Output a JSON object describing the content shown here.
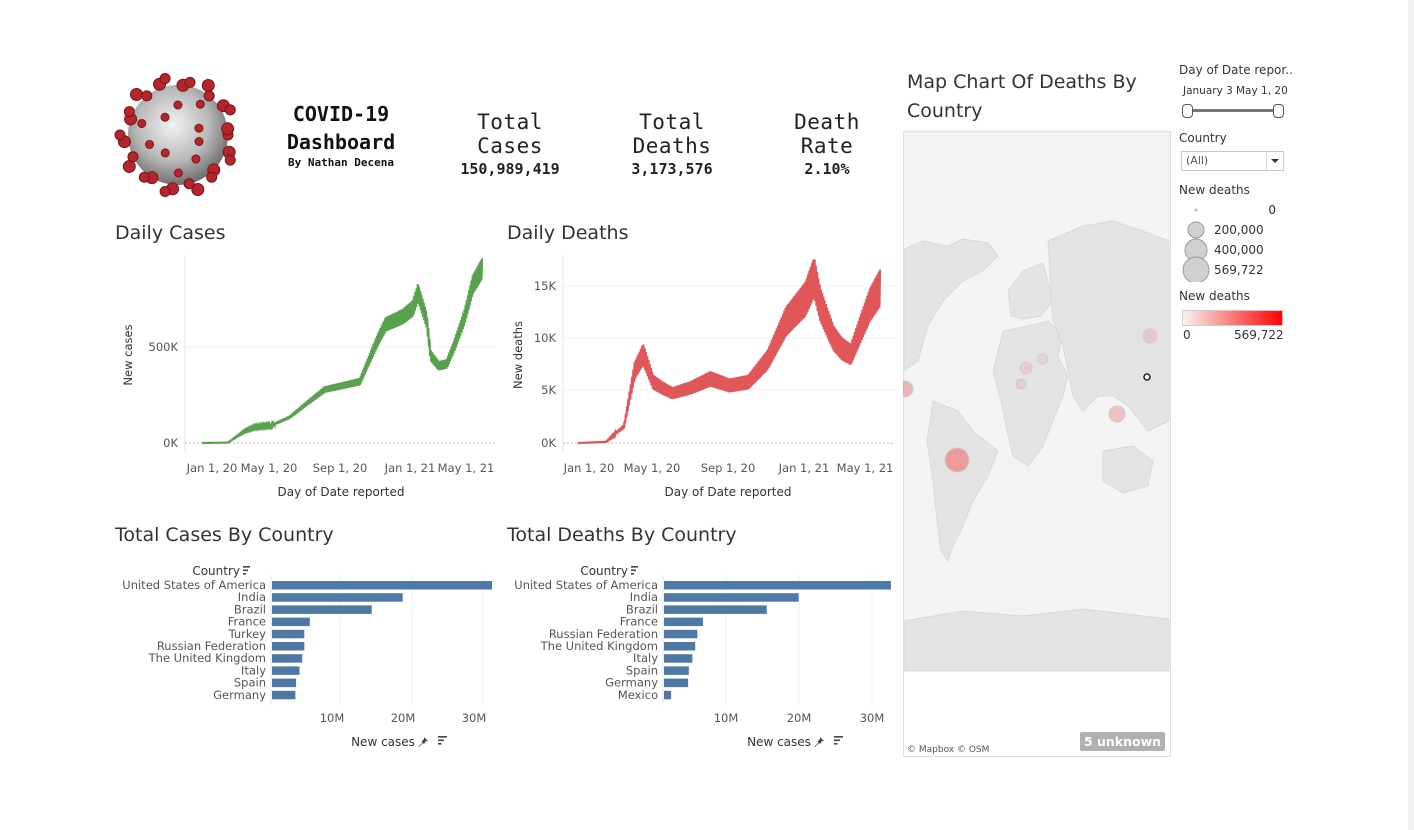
{
  "header": {
    "title": "COVID-19 Dashboard",
    "title_line1": "COVID-19",
    "title_line2": "Dashboard",
    "subtitle": "By Nathan Decena",
    "kpis": [
      {
        "label": "Total Cases",
        "value": "150,989,419"
      },
      {
        "label": "Total Deaths",
        "value": "3,173,576"
      },
      {
        "label": "Death Rate",
        "value": "2.10%"
      }
    ]
  },
  "colors": {
    "cases_line": "#59a14f",
    "deaths_line": "#e15759",
    "bar": "#4e79a7",
    "map_land": "#e6e6e6",
    "map_water": "#ffffff"
  },
  "daily_cases": {
    "title": "Daily Cases",
    "xlabel": "Day of Date reported",
    "ylabel": "New cases",
    "ticks_x": [
      "Jan 1, 20",
      "May 1, 20",
      "Sep 1, 20",
      "Jan 1, 21",
      "May 1, 21"
    ],
    "ticks_y": [
      "0K",
      "500K"
    ]
  },
  "daily_deaths": {
    "title": "Daily Deaths",
    "xlabel": "Day of Date reported",
    "ylabel": "New deaths",
    "ticks_x": [
      "Jan 1, 20",
      "May 1, 20",
      "Sep 1, 20",
      "Jan 1, 21",
      "May 1, 21"
    ],
    "ticks_y": [
      "0K",
      "5K",
      "10K",
      "15K"
    ]
  },
  "cases_by_country": {
    "title": "Total Cases By Country",
    "dim_label": "Country",
    "measure_label": "New cases",
    "ticks_x": [
      "10M",
      "20M",
      "30M"
    ]
  },
  "deaths_by_country": {
    "title": "Total Deaths By Country",
    "dim_label": "Country",
    "measure_label": "New cases",
    "ticks_x": [
      "10M",
      "20M",
      "30M"
    ]
  },
  "map": {
    "title_line1": "Map Chart Of  Deaths By",
    "title_line2": "Country",
    "attribution": "© Mapbox © OSM",
    "unknown_badge": "5 unknown"
  },
  "filters": {
    "date": {
      "label": "Day of Date repor..",
      "start": "January 3",
      "end": "May 1, 20"
    },
    "country": {
      "label": "Country",
      "value": "(All)"
    },
    "size_legend": {
      "title": "New deaths",
      "items": [
        "0",
        "200,000",
        "400,000",
        "569,722"
      ]
    },
    "color_legend": {
      "title": "New deaths",
      "min": "0",
      "max": "569,722"
    }
  },
  "chart_data": [
    {
      "type": "line",
      "title": "Daily Cases",
      "xlabel": "Day of Date reported",
      "ylabel": "New cases",
      "ylim": [
        0,
        950000
      ],
      "x": [
        "2020-01-01",
        "2020-02-15",
        "2020-03-15",
        "2020-04-01",
        "2020-05-01",
        "2020-06-01",
        "2020-07-01",
        "2020-08-01",
        "2020-09-01",
        "2020-10-01",
        "2020-11-01",
        "2020-11-15",
        "2020-12-01",
        "2020-12-15",
        "2021-01-01",
        "2021-01-10",
        "2021-01-25",
        "2021-02-01",
        "2021-02-15",
        "2021-03-01",
        "2021-03-15",
        "2021-04-01",
        "2021-04-15",
        "2021-05-01"
      ],
      "series": [
        {
          "values": [
            0,
            2000,
            60000,
            80000,
            90000,
            130000,
            200000,
            270000,
            290000,
            310000,
            520000,
            600000,
            620000,
            640000,
            680000,
            760000,
            620000,
            440000,
            390000,
            400000,
            500000,
            640000,
            800000,
            880000
          ]
        }
      ]
    },
    {
      "type": "line",
      "title": "Daily Deaths",
      "xlabel": "Day of Date reported",
      "ylabel": "New deaths",
      "ylim": [
        0,
        17000
      ],
      "x": [
        "2020-01-01",
        "2020-02-15",
        "2020-03-15",
        "2020-04-01",
        "2020-04-15",
        "2020-05-01",
        "2020-05-15",
        "2020-06-01",
        "2020-07-01",
        "2020-08-01",
        "2020-09-01",
        "2020-10-01",
        "2020-11-01",
        "2020-12-01",
        "2021-01-01",
        "2021-01-15",
        "2021-01-25",
        "2021-02-15",
        "2021-03-01",
        "2021-03-15",
        "2021-04-01",
        "2021-04-15",
        "2021-05-01"
      ],
      "series": [
        {
          "values": [
            0,
            100,
            1500,
            6500,
            8000,
            5500,
            5000,
            4500,
            5000,
            5800,
            5200,
            5500,
            7500,
            11000,
            13000,
            15000,
            12500,
            9500,
            8500,
            8000,
            10500,
            12500,
            14000
          ]
        }
      ]
    },
    {
      "type": "bar",
      "title": "Total Cases By Country",
      "xlabel": "New cases",
      "ylabel": "Country",
      "xlim": [
        0,
        33000000
      ],
      "categories": [
        "United States of America",
        "India",
        "Brazil",
        "France",
        "Turkey",
        "Russian Federation",
        "The United Kingdom",
        "Italy",
        "Spain",
        "Germany"
      ],
      "values": [
        32000000,
        19000000,
        14500000,
        5500000,
        4700000,
        4700000,
        4400000,
        4000000,
        3500000,
        3400000
      ]
    },
    {
      "type": "bar",
      "title": "Total Deaths By Country",
      "xlabel": "New cases",
      "ylabel": "Country",
      "xlim": [
        0,
        33000000
      ],
      "categories": [
        "United States of America",
        "India",
        "Brazil",
        "France",
        "Russian Federation",
        "The United Kingdom",
        "Italy",
        "Spain",
        "Germany",
        "Mexico"
      ],
      "values": [
        32000000,
        19000000,
        14500000,
        5500000,
        4700000,
        4400000,
        4000000,
        3500000,
        3400000,
        1000000
      ]
    }
  ]
}
